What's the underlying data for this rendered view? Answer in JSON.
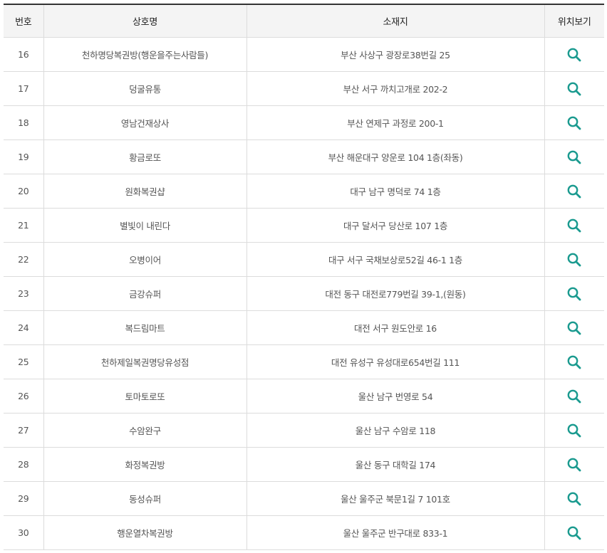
{
  "table": {
    "headers": {
      "no": "번호",
      "name": "상호명",
      "address": "소재지",
      "location": "위치보기"
    },
    "accent_color": "#1a9a8f",
    "rows": [
      {
        "no": "16",
        "name": "천하명당복권방(행운을주는사람들)",
        "address": "부산 사상구 광장로38번길 25",
        "icon": "search-icon"
      },
      {
        "no": "17",
        "name": "덩굴유통",
        "address": "부산 서구 까치고개로 202-2",
        "icon": "search-icon"
      },
      {
        "no": "18",
        "name": "영남건재상사",
        "address": "부산 연제구 과정로 200-1",
        "icon": "search-icon"
      },
      {
        "no": "19",
        "name": "황금로또",
        "address": "부산 해운대구 양운로 104 1층(좌동)",
        "icon": "search-icon"
      },
      {
        "no": "20",
        "name": "원화복권샵",
        "address": "대구 남구 명덕로 74 1층",
        "icon": "search-icon"
      },
      {
        "no": "21",
        "name": "별빛이 내린다",
        "address": "대구 달서구 당산로 107 1층",
        "icon": "search-icon"
      },
      {
        "no": "22",
        "name": "오병이어",
        "address": "대구 서구 국채보상로52길 46-1 1층",
        "icon": "search-icon"
      },
      {
        "no": "23",
        "name": "금강슈퍼",
        "address": "대전 동구 대전로779번길 39-1,(원동)",
        "icon": "search-icon"
      },
      {
        "no": "24",
        "name": "복드림마트",
        "address": "대전 서구 원도안로 16",
        "icon": "search-icon"
      },
      {
        "no": "25",
        "name": "천하제일복권명당유성점",
        "address": "대전 유성구 유성대로654번길 111",
        "icon": "search-icon"
      },
      {
        "no": "26",
        "name": "토마토로또",
        "address": "울산 남구 번영로 54",
        "icon": "search-icon"
      },
      {
        "no": "27",
        "name": "수암완구",
        "address": "울산 남구 수암로 118",
        "icon": "search-icon"
      },
      {
        "no": "28",
        "name": "화정복권방",
        "address": "울산 동구 대학길 174",
        "icon": "search-icon"
      },
      {
        "no": "29",
        "name": "동성슈퍼",
        "address": "울산 울주군 북문1길 7 101호",
        "icon": "search-icon"
      },
      {
        "no": "30",
        "name": "행운열차복권방",
        "address": "울산 울주군 반구대로 833-1",
        "icon": "search-icon"
      }
    ]
  }
}
